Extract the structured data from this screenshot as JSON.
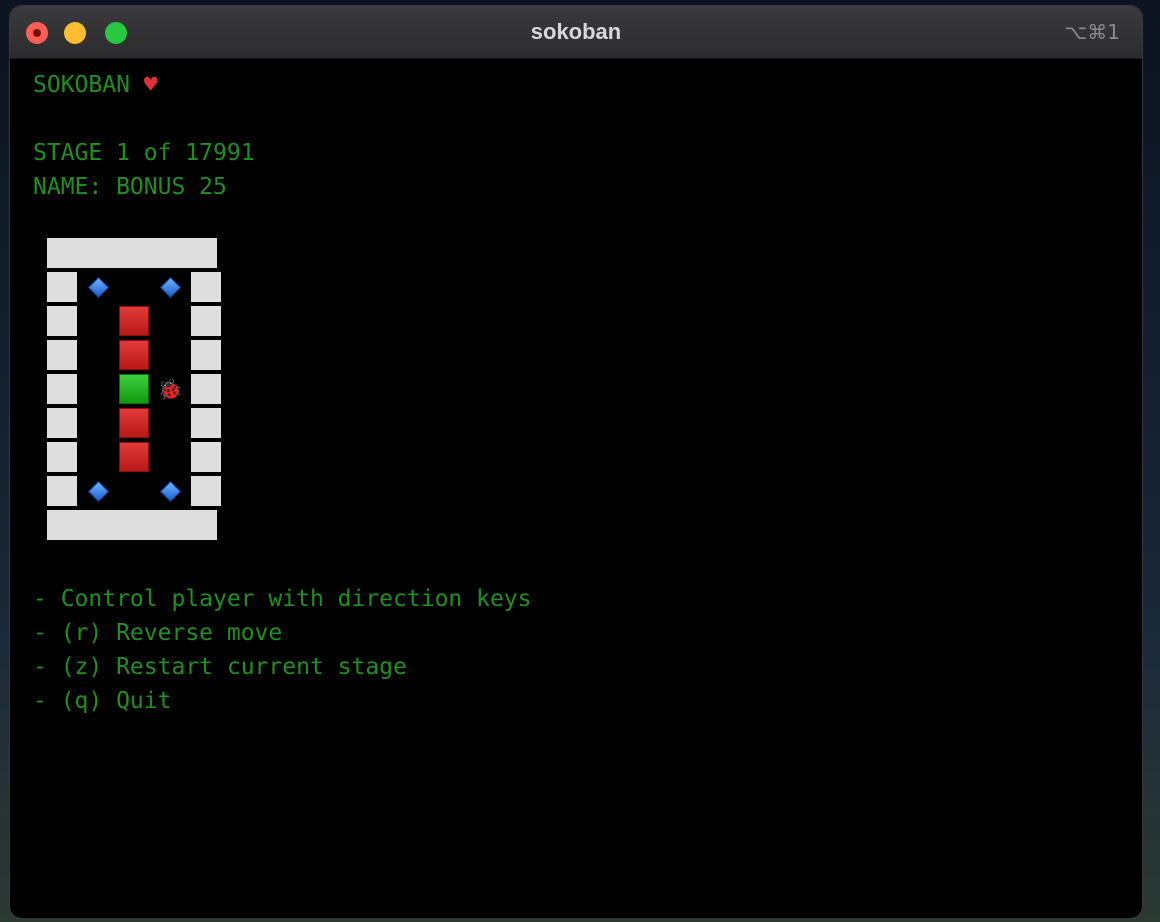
{
  "window": {
    "title": "sokoban",
    "shortcut": "⌥⌘1"
  },
  "header": {
    "title": "SOKOBAN",
    "heart_icon": "heart-icon",
    "stage_line": "STAGE 1 of 17991",
    "name_line": "NAME: BONUS 25"
  },
  "board": {
    "legend": {
      "wall": "light-gray-block",
      "box": "red-square",
      "box_on_goal": "green-square",
      "goal": "blue-diamond",
      "player": "ladybug"
    },
    "rows": [
      "#####",
      "#. .#",
      "# $ #",
      "# $ #",
      "# *@#",
      "# $ #",
      "# $ #",
      "#. .#",
      "#####"
    ],
    "player_glyph": "🐞"
  },
  "help": {
    "items": [
      "- Control player with direction keys",
      "- (r) Reverse move",
      "- (z) Restart current stage",
      "- (q) Quit"
    ]
  }
}
